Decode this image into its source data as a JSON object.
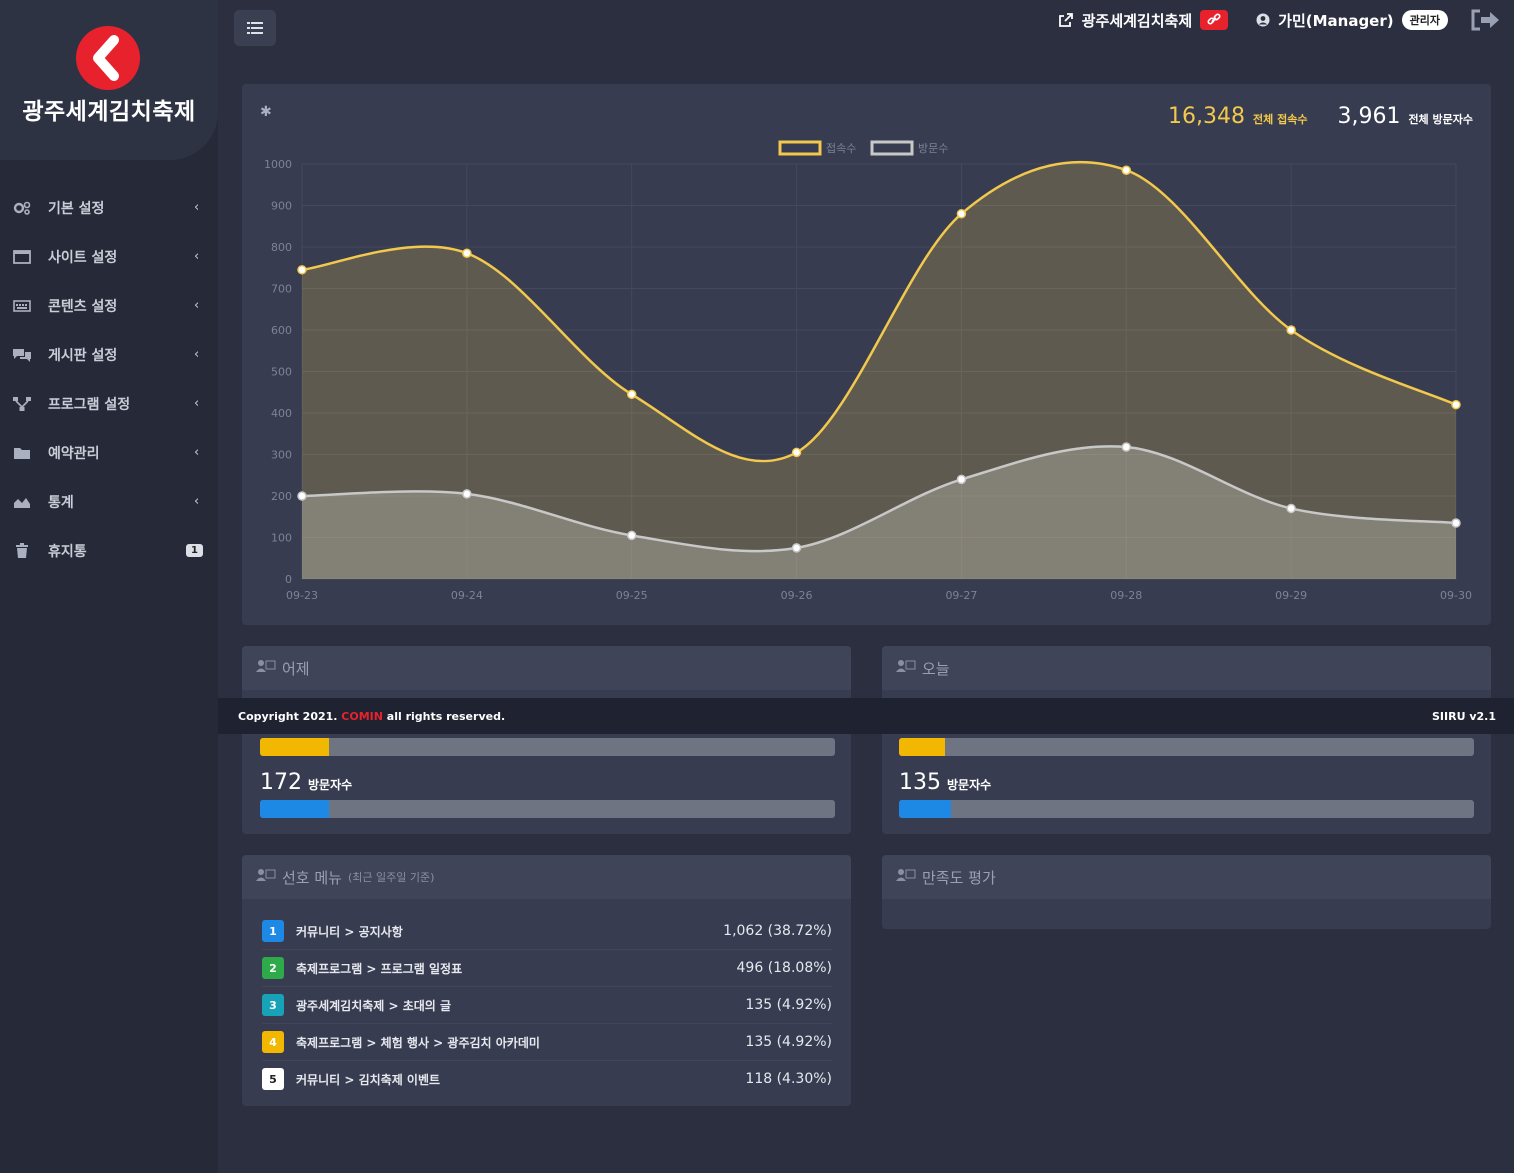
{
  "brand": {
    "name": "광주세계김치축제",
    "logo_icon": "chevron-left-logo",
    "accent": "#e8222d"
  },
  "sidebar": {
    "items": [
      {
        "label": "기본 설정",
        "icon": "gear-icon",
        "chevron": "‹"
      },
      {
        "label": "사이트 설정",
        "icon": "window-icon",
        "chevron": "‹"
      },
      {
        "label": "콘텐츠 설정",
        "icon": "keyboard-icon",
        "chevron": "‹"
      },
      {
        "label": "게시판 설정",
        "icon": "comments-icon",
        "chevron": "‹"
      },
      {
        "label": "프로그램 설정",
        "icon": "sitemap-icon",
        "chevron": "‹"
      },
      {
        "label": "예약관리",
        "icon": "folder-icon",
        "chevron": "‹"
      },
      {
        "label": "통계",
        "icon": "area-chart-icon",
        "chevron": "‹"
      },
      {
        "label": "휴지통",
        "icon": "trash-icon",
        "badge": "1"
      }
    ]
  },
  "topbar": {
    "site_link": "광주세계김치축제",
    "user": "가민(Manager)",
    "role_badge": "관리자"
  },
  "totals": {
    "visits": "16,348",
    "visits_label": "전체 접속수",
    "visitors": "3,961",
    "visitors_label": "전체 방문자수"
  },
  "chart_data": {
    "type": "area",
    "x": [
      "09-23",
      "09-24",
      "09-25",
      "09-26",
      "09-27",
      "09-28",
      "09-29",
      "09-30"
    ],
    "ylim": [
      0,
      1000
    ],
    "yticks": [
      0,
      100,
      200,
      300,
      400,
      500,
      600,
      700,
      800,
      900,
      1000
    ],
    "series": [
      {
        "name": "접속수",
        "color": "#f2c94c",
        "values": [
          745,
          785,
          445,
          305,
          880,
          985,
          600,
          420
        ]
      },
      {
        "name": "방문수",
        "color": "#c8c8c8",
        "values": [
          200,
          205,
          105,
          75,
          240,
          318,
          170,
          135
        ]
      }
    ],
    "legend": "top-center",
    "grid": true
  },
  "yesterday": {
    "title": "어제",
    "visitors": "172",
    "unit": "방문자수",
    "yellow_fill": 0.12,
    "blue_fill": 0.12
  },
  "today": {
    "title": "오늘",
    "visitors": "135",
    "unit": "방문자수",
    "yellow_fill": 0.08,
    "blue_fill": 0.09
  },
  "footer": {
    "prefix": "Copyright 2021. ",
    "company": "COMIN",
    "suffix": " all rights reserved.",
    "version": "SIIRU v2.1"
  },
  "popular": {
    "title": "선호 메뉴",
    "subtitle": "(최근 일주일 기준)",
    "rows": [
      {
        "rank": "1",
        "name": "커뮤니티 > 공지사항",
        "value": "1,062 (38.72%)",
        "color": "#1e88e5"
      },
      {
        "rank": "2",
        "name": "축제프로그램 > 프로그램 일정표",
        "value": "496 (18.08%)",
        "color": "#2eaa4a"
      },
      {
        "rank": "3",
        "name": "광주세계김치축제 > 초대의 글",
        "value": "135 (4.92%)",
        "color": "#17a2b8"
      },
      {
        "rank": "4",
        "name": "축제프로그램 > 체험 행사 > 광주김치 아카데미",
        "value": "135 (4.92%)",
        "color": "#f2b700"
      },
      {
        "rank": "5",
        "name": "커뮤니티 > 김치축제 이벤트",
        "value": "118 (4.30%)",
        "color": "#ffffff"
      }
    ]
  },
  "satisfaction": {
    "title": "만족도 평가"
  }
}
